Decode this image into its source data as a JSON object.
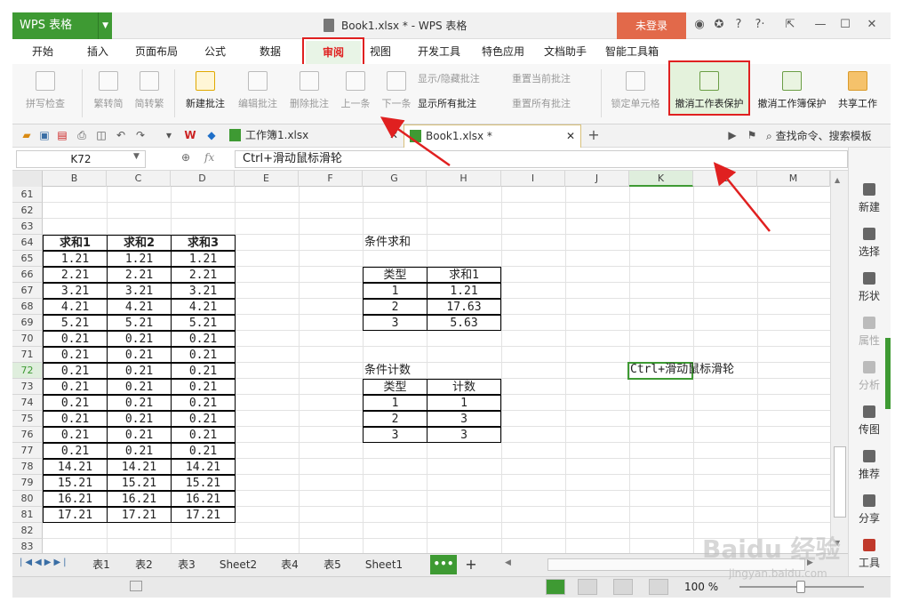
{
  "app": {
    "button_label": "WPS 表格",
    "window_title": "Book1.xlsx * - WPS 表格",
    "login_label": "未登录"
  },
  "menu": {
    "tabs": [
      "开始",
      "插入",
      "页面布局",
      "公式",
      "数据",
      "审阅",
      "视图",
      "开发工具",
      "特色应用",
      "文档助手",
      "智能工具箱"
    ],
    "active": "审阅"
  },
  "ribbon": {
    "spellcheck": "拼写检查",
    "trad_to_simp": "繁转简",
    "simp_to_trad": "简转繁",
    "new_comment": "新建批注",
    "edit_comment": "编辑批注",
    "delete_comment": "删除批注",
    "prev": "上一条",
    "next": "下一条",
    "show_hide_comment": "显示/隐藏批注",
    "reset_current_comment": "重置当前批注",
    "show_all_comments": "显示所有批注",
    "reset_all_comments": "重置所有批注",
    "lock_cell": "锁定单元格",
    "unprotect_sheet": "撤消工作表保护",
    "unprotect_workbook": "撤消工作簿保护",
    "share_workbook": "共享工作"
  },
  "doc_tabs": [
    "工作簿1.xlsx",
    "Book1.xlsx *"
  ],
  "search_cmd": "查找命令、搜索模板",
  "formula_bar": {
    "name_box": "K72",
    "fx": "fx",
    "value": "Ctrl+滑动鼠标滑轮"
  },
  "columns": [
    "B",
    "C",
    "D",
    "E",
    "F",
    "G",
    "H",
    "I",
    "J",
    "K",
    "L",
    "M"
  ],
  "rows": [
    "61",
    "62",
    "63",
    "64",
    "65",
    "66",
    "67",
    "68",
    "69",
    "70",
    "71",
    "72",
    "73",
    "74",
    "75",
    "76",
    "77",
    "78",
    "79",
    "80",
    "81",
    "82",
    "83"
  ],
  "main_table": {
    "headers": [
      "求和1",
      "求和2",
      "求和3"
    ],
    "values": [
      "1.21",
      "2.21",
      "3.21",
      "4.21",
      "5.21",
      "0.21",
      "0.21",
      "0.21",
      "0.21",
      "0.21",
      "0.21",
      "0.21",
      "0.21",
      "14.21",
      "15.21",
      "16.21",
      "17.21"
    ]
  },
  "cond_sum": {
    "label": "条件求和",
    "headers": [
      "类型",
      "求和1"
    ],
    "rows": [
      [
        "1",
        "1.21"
      ],
      [
        "2",
        "17.63"
      ],
      [
        "3",
        "5.63"
      ]
    ]
  },
  "cond_count": {
    "label": "条件计数",
    "headers": [
      "类型",
      "计数"
    ],
    "rows": [
      [
        "1",
        "1"
      ],
      [
        "2",
        "3"
      ],
      [
        "3",
        "3"
      ]
    ]
  },
  "k72_value": "Ctrl+滑动鼠标滑轮",
  "sidebar": [
    "新建",
    "选择",
    "形状",
    "属性",
    "分析",
    "传图",
    "推荐",
    "分享",
    "工具"
  ],
  "sheets": [
    "表1",
    "表2",
    "表3",
    "Sheet2",
    "表4",
    "表5",
    "Sheet1"
  ],
  "add_sheet_dots": "•••",
  "add_sheet_plus": "+",
  "zoom": "100 %",
  "watermark": "Baidu 经验",
  "watermark_url": "jingyan.baidu.com",
  "colors": {
    "brand_green": "#3e9a33",
    "login": "#e2694a",
    "annotation_red": "#e02020"
  }
}
